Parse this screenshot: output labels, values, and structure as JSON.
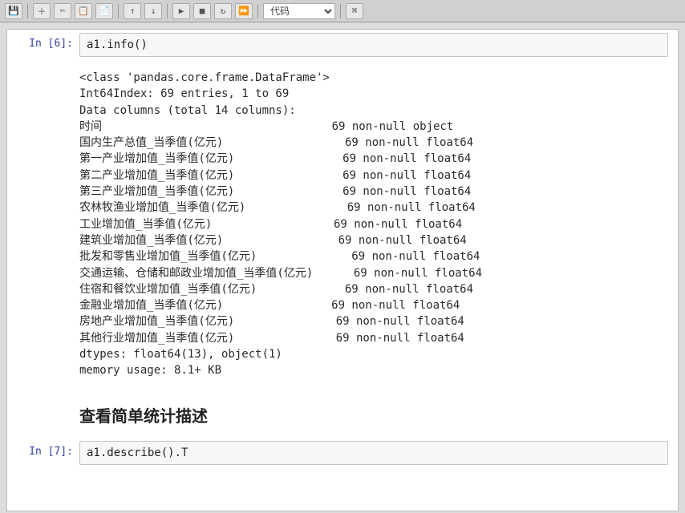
{
  "toolbar": {
    "kernel_select": "代码"
  },
  "cell6": {
    "prompt": "In [6]:",
    "code": "a1.info()"
  },
  "output6": {
    "lines": [
      "<class 'pandas.core.frame.DataFrame'>",
      "Int64Index: 69 entries, 1 to 69",
      "Data columns (total 14 columns):",
      "时间                                  69 non-null object",
      "国内生产总值_当季值(亿元)                  69 non-null float64",
      "第一产业增加值_当季值(亿元)                69 non-null float64",
      "第二产业增加值_当季值(亿元)                69 non-null float64",
      "第三产业增加值_当季值(亿元)                69 non-null float64",
      "农林牧渔业增加值_当季值(亿元)               69 non-null float64",
      "工业增加值_当季值(亿元)                  69 non-null float64",
      "建筑业增加值_当季值(亿元)                 69 non-null float64",
      "批发和零售业增加值_当季值(亿元)              69 non-null float64",
      "交通运输、仓储和邮政业增加值_当季值(亿元)      69 non-null float64",
      "住宿和餐饮业增加值_当季值(亿元)             69 non-null float64",
      "金融业增加值_当季值(亿元)                69 non-null float64",
      "房地产业增加值_当季值(亿元)               69 non-null float64",
      "其他行业增加值_当季值(亿元)               69 non-null float64",
      "dtypes: float64(13), object(1)",
      "memory usage: 8.1+ KB"
    ]
  },
  "markdown": {
    "heading": "查看简单统计描述"
  },
  "cell7": {
    "prompt": "In [7]:",
    "code": "a1.describe().T"
  }
}
